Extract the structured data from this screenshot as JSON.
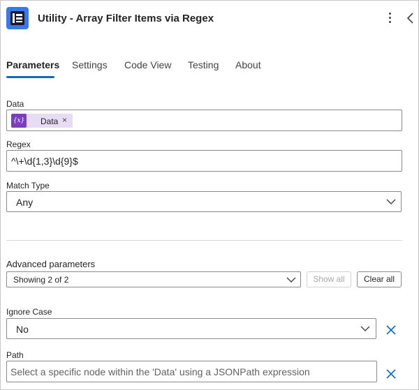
{
  "header": {
    "title": "Utility - Array Filter Items via Regex",
    "app_icon": "list-document-icon",
    "more_icon": "more-vertical-icon",
    "collapse_icon": "chevron-left-icon"
  },
  "tabs": [
    {
      "label": "Parameters",
      "active": true
    },
    {
      "label": "Settings",
      "active": false
    },
    {
      "label": "Code View",
      "active": false
    },
    {
      "label": "Testing",
      "active": false
    },
    {
      "label": "About",
      "active": false
    }
  ],
  "fields": {
    "data": {
      "label": "Data",
      "token_icon_text": "{x}",
      "token_label": "Data",
      "token_remove": "×"
    },
    "regex": {
      "label": "Regex",
      "value": "^\\+\\d{1,3}\\d{9}$"
    },
    "match_type": {
      "label": "Match Type",
      "value": "Any"
    },
    "advanced": {
      "label": "Advanced parameters",
      "value": "Showing 2 of 2",
      "show_all": "Show all",
      "clear_all": "Clear all"
    },
    "ignore_case": {
      "label": "Ignore Case",
      "value": "No"
    },
    "path": {
      "label": "Path",
      "placeholder": "Select a specific node within the 'Data' using a JSONPath expression"
    }
  },
  "colors": {
    "accent": "#0f6cbd",
    "token_bg": "#e8dcf5",
    "token_icon": "#7b3fbd",
    "app_icon_bg": "#3b78e7"
  }
}
